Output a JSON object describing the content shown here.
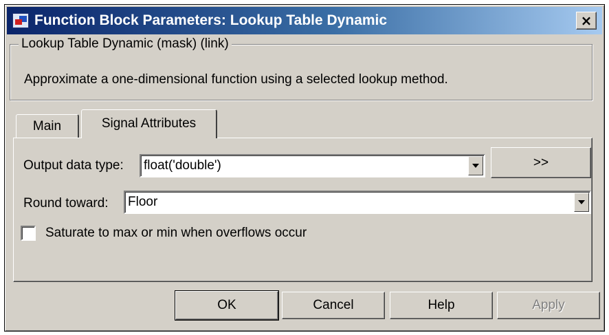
{
  "window": {
    "title": "Function Block Parameters: Lookup Table Dynamic",
    "close_label": "×"
  },
  "group": {
    "legend": "Lookup Table Dynamic (mask) (link)",
    "description": "Approximate a one-dimensional function using a selected lookup method."
  },
  "tabs": [
    {
      "label": "Main",
      "active": false
    },
    {
      "label": "Signal Attributes",
      "active": true
    }
  ],
  "params": {
    "output_data_type": {
      "label": "Output data type:",
      "value": "float('double')"
    },
    "data_type_assistant_label": ">>",
    "round_toward": {
      "label": "Round toward:",
      "value": "Floor"
    },
    "saturate": {
      "label": "Saturate to max or min when overflows occur",
      "checked": false
    }
  },
  "buttons": {
    "ok": "OK",
    "cancel": "Cancel",
    "help": "Help",
    "apply": "Apply"
  }
}
